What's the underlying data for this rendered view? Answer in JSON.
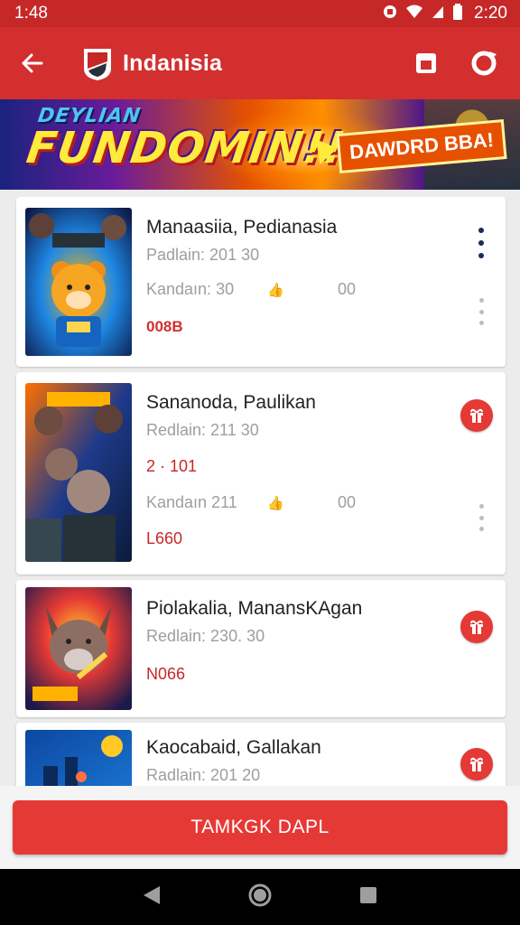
{
  "status_bar": {
    "time_left": "1:48",
    "time_right": "2:20"
  },
  "app_bar": {
    "title": "Indanisia"
  },
  "banner": {
    "small_text": "DEYLIAN",
    "title": "FUNDOMIN!!",
    "badge": "DAWDRD BBA!"
  },
  "cards": [
    {
      "title": "Manaasiia, Pedianasia",
      "line1": "Padlain: 201 30",
      "line2": "Kandaın: 30",
      "likes": "00",
      "code": "008B",
      "action": "more-dark"
    },
    {
      "title": "Sananoda, Paulikan",
      "line1": "Redlain: 211 30",
      "extra": "2 · 101",
      "line2": "Kandaın 211",
      "likes": "00",
      "code": "L660",
      "action": "gift"
    },
    {
      "title": "Piolakalia, ManansKAgan",
      "line1": "Redlain: 230. 30",
      "code": "N066",
      "action": "gift"
    },
    {
      "title": "Kaocabaid, Gallakan",
      "line1": "Radlain: 201 20",
      "action": "gift"
    }
  ],
  "cta": {
    "label": "TAMKGK DAPL"
  },
  "colors": {
    "primary": "#d32f2f",
    "status_bar": "#c62828",
    "accent_code": "#d32f2f",
    "background": "#ececec"
  },
  "icons": {
    "back": "arrow-left-icon",
    "bookmark": "bookmark-icon",
    "refresh": "refresh-icon",
    "gift": "gift-icon",
    "more": "more-vertical-icon",
    "like": "thumbs-up-icon"
  }
}
